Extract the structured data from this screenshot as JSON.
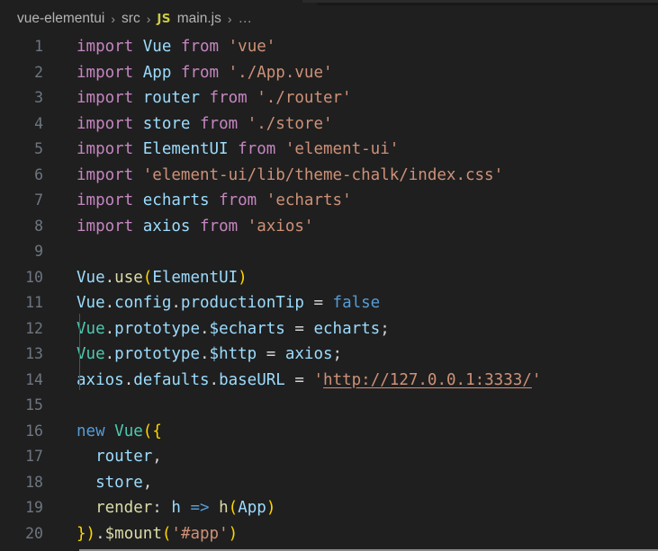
{
  "window": {
    "title": "main.js"
  },
  "breadcrumb": {
    "items": [
      {
        "label": "vue-elementui",
        "icon": ""
      },
      {
        "label": "src",
        "icon": ""
      },
      {
        "label": "main.js",
        "icon": "js-file-icon",
        "badge": "JS"
      }
    ],
    "separator": "›",
    "ellipsis": "…"
  },
  "editor": {
    "language": "javascript",
    "first_line": 1,
    "last_line": 20,
    "colors": {
      "background": "#1f1f1f",
      "line_number": "#6e7681",
      "keyword": "#c586c0",
      "control": "#569cd6",
      "variable": "#9cdcfe",
      "string": "#ce9178",
      "function": "#dcdcaa",
      "type": "#4ec9b0",
      "plain": "#d4d4d4",
      "bracket": "#ffd700"
    },
    "lines": [
      {
        "n": "1",
        "tokens": [
          {
            "t": "import",
            "c": "t-kw"
          },
          {
            "t": " ",
            "c": "t-plain"
          },
          {
            "t": "Vue",
            "c": "t-var"
          },
          {
            "t": " ",
            "c": "t-plain"
          },
          {
            "t": "from",
            "c": "t-kw"
          },
          {
            "t": " ",
            "c": "t-plain"
          },
          {
            "t": "'vue'",
            "c": "t-str"
          }
        ]
      },
      {
        "n": "2",
        "tokens": [
          {
            "t": "import",
            "c": "t-kw"
          },
          {
            "t": " ",
            "c": "t-plain"
          },
          {
            "t": "App",
            "c": "t-var"
          },
          {
            "t": " ",
            "c": "t-plain"
          },
          {
            "t": "from",
            "c": "t-kw"
          },
          {
            "t": " ",
            "c": "t-plain"
          },
          {
            "t": "'./App.vue'",
            "c": "t-str"
          }
        ]
      },
      {
        "n": "3",
        "tokens": [
          {
            "t": "import",
            "c": "t-kw"
          },
          {
            "t": " ",
            "c": "t-plain"
          },
          {
            "t": "router",
            "c": "t-var"
          },
          {
            "t": " ",
            "c": "t-plain"
          },
          {
            "t": "from",
            "c": "t-kw"
          },
          {
            "t": " ",
            "c": "t-plain"
          },
          {
            "t": "'./router'",
            "c": "t-str"
          }
        ]
      },
      {
        "n": "4",
        "tokens": [
          {
            "t": "import",
            "c": "t-kw"
          },
          {
            "t": " ",
            "c": "t-plain"
          },
          {
            "t": "store",
            "c": "t-var"
          },
          {
            "t": " ",
            "c": "t-plain"
          },
          {
            "t": "from",
            "c": "t-kw"
          },
          {
            "t": " ",
            "c": "t-plain"
          },
          {
            "t": "'./store'",
            "c": "t-str"
          }
        ]
      },
      {
        "n": "5",
        "tokens": [
          {
            "t": "import",
            "c": "t-kw"
          },
          {
            "t": " ",
            "c": "t-plain"
          },
          {
            "t": "ElementUI",
            "c": "t-var"
          },
          {
            "t": " ",
            "c": "t-plain"
          },
          {
            "t": "from",
            "c": "t-kw"
          },
          {
            "t": " ",
            "c": "t-plain"
          },
          {
            "t": "'element-ui'",
            "c": "t-str"
          }
        ]
      },
      {
        "n": "6",
        "tokens": [
          {
            "t": "import",
            "c": "t-kw"
          },
          {
            "t": " ",
            "c": "t-plain"
          },
          {
            "t": "'element-ui/lib/theme-chalk/index.css'",
            "c": "t-str"
          }
        ]
      },
      {
        "n": "7",
        "tokens": [
          {
            "t": "import",
            "c": "t-kw"
          },
          {
            "t": " ",
            "c": "t-plain"
          },
          {
            "t": "echarts",
            "c": "t-var"
          },
          {
            "t": " ",
            "c": "t-plain"
          },
          {
            "t": "from",
            "c": "t-kw"
          },
          {
            "t": " ",
            "c": "t-plain"
          },
          {
            "t": "'echarts'",
            "c": "t-str"
          }
        ]
      },
      {
        "n": "8",
        "tokens": [
          {
            "t": "import",
            "c": "t-kw"
          },
          {
            "t": " ",
            "c": "t-plain"
          },
          {
            "t": "axios",
            "c": "t-var"
          },
          {
            "t": " ",
            "c": "t-plain"
          },
          {
            "t": "from",
            "c": "t-kw"
          },
          {
            "t": " ",
            "c": "t-plain"
          },
          {
            "t": "'axios'",
            "c": "t-str"
          }
        ]
      },
      {
        "n": "9",
        "tokens": []
      },
      {
        "n": "10",
        "tokens": [
          {
            "t": "Vue",
            "c": "t-var"
          },
          {
            "t": ".",
            "c": "t-plain"
          },
          {
            "t": "use",
            "c": "t-fn"
          },
          {
            "t": "(",
            "c": "t-br1"
          },
          {
            "t": "ElementUI",
            "c": "t-var"
          },
          {
            "t": ")",
            "c": "t-br1"
          }
        ]
      },
      {
        "n": "11",
        "tokens": [
          {
            "t": "Vue",
            "c": "t-var"
          },
          {
            "t": ".",
            "c": "t-plain"
          },
          {
            "t": "config",
            "c": "t-var"
          },
          {
            "t": ".",
            "c": "t-plain"
          },
          {
            "t": "productionTip",
            "c": "t-var"
          },
          {
            "t": " ",
            "c": "t-plain"
          },
          {
            "t": "=",
            "c": "t-plain"
          },
          {
            "t": " ",
            "c": "t-plain"
          },
          {
            "t": "false",
            "c": "t-ctrl"
          }
        ]
      },
      {
        "n": "12",
        "tokens": [
          {
            "t": "Vue",
            "c": "t-type"
          },
          {
            "t": ".",
            "c": "t-plain"
          },
          {
            "t": "prototype",
            "c": "t-var"
          },
          {
            "t": ".",
            "c": "t-plain"
          },
          {
            "t": "$echarts",
            "c": "t-var"
          },
          {
            "t": " ",
            "c": "t-plain"
          },
          {
            "t": "=",
            "c": "t-plain"
          },
          {
            "t": " ",
            "c": "t-plain"
          },
          {
            "t": "echarts",
            "c": "t-var"
          },
          {
            "t": ";",
            "c": "t-plain"
          }
        ]
      },
      {
        "n": "13",
        "tokens": [
          {
            "t": "Vue",
            "c": "t-type"
          },
          {
            "t": ".",
            "c": "t-plain"
          },
          {
            "t": "prototype",
            "c": "t-var"
          },
          {
            "t": ".",
            "c": "t-plain"
          },
          {
            "t": "$http",
            "c": "t-var"
          },
          {
            "t": " ",
            "c": "t-plain"
          },
          {
            "t": "=",
            "c": "t-plain"
          },
          {
            "t": " ",
            "c": "t-plain"
          },
          {
            "t": "axios",
            "c": "t-var"
          },
          {
            "t": ";",
            "c": "t-plain"
          }
        ]
      },
      {
        "n": "14",
        "tokens": [
          {
            "t": "axios",
            "c": "t-var"
          },
          {
            "t": ".",
            "c": "t-plain"
          },
          {
            "t": "defaults",
            "c": "t-var"
          },
          {
            "t": ".",
            "c": "t-plain"
          },
          {
            "t": "baseURL",
            "c": "t-var"
          },
          {
            "t": " ",
            "c": "t-plain"
          },
          {
            "t": "=",
            "c": "t-plain"
          },
          {
            "t": " ",
            "c": "t-plain"
          },
          {
            "t": "'",
            "c": "t-str"
          },
          {
            "t": "http://127.0.0.1:3333/",
            "c": "t-link"
          },
          {
            "t": "'",
            "c": "t-str"
          }
        ]
      },
      {
        "n": "15",
        "tokens": []
      },
      {
        "n": "16",
        "tokens": [
          {
            "t": "new",
            "c": "t-ctrl"
          },
          {
            "t": " ",
            "c": "t-plain"
          },
          {
            "t": "Vue",
            "c": "t-type"
          },
          {
            "t": "(",
            "c": "t-br1"
          },
          {
            "t": "{",
            "c": "t-br1"
          }
        ]
      },
      {
        "n": "17",
        "tokens": [
          {
            "t": "  ",
            "c": "t-plain"
          },
          {
            "t": "router",
            "c": "t-var"
          },
          {
            "t": ",",
            "c": "t-plain"
          }
        ]
      },
      {
        "n": "18",
        "tokens": [
          {
            "t": "  ",
            "c": "t-plain"
          },
          {
            "t": "store",
            "c": "t-var"
          },
          {
            "t": ",",
            "c": "t-plain"
          }
        ]
      },
      {
        "n": "19",
        "tokens": [
          {
            "t": "  ",
            "c": "t-plain"
          },
          {
            "t": "render",
            "c": "t-prop"
          },
          {
            "t": ":",
            "c": "t-plain"
          },
          {
            "t": " ",
            "c": "t-plain"
          },
          {
            "t": "h",
            "c": "t-var"
          },
          {
            "t": " ",
            "c": "t-plain"
          },
          {
            "t": "=>",
            "c": "t-ctrl"
          },
          {
            "t": " ",
            "c": "t-plain"
          },
          {
            "t": "h",
            "c": "t-fn"
          },
          {
            "t": "(",
            "c": "t-br1"
          },
          {
            "t": "App",
            "c": "t-var"
          },
          {
            "t": ")",
            "c": "t-br1"
          }
        ]
      },
      {
        "n": "20",
        "tokens": [
          {
            "t": "}",
            "c": "t-br1"
          },
          {
            "t": ")",
            "c": "t-br1"
          },
          {
            "t": ".",
            "c": "t-plain"
          },
          {
            "t": "$mount",
            "c": "t-fn"
          },
          {
            "t": "(",
            "c": "t-br1"
          },
          {
            "t": "'#app'",
            "c": "t-str"
          },
          {
            "t": ")",
            "c": "t-br1"
          }
        ]
      }
    ]
  }
}
